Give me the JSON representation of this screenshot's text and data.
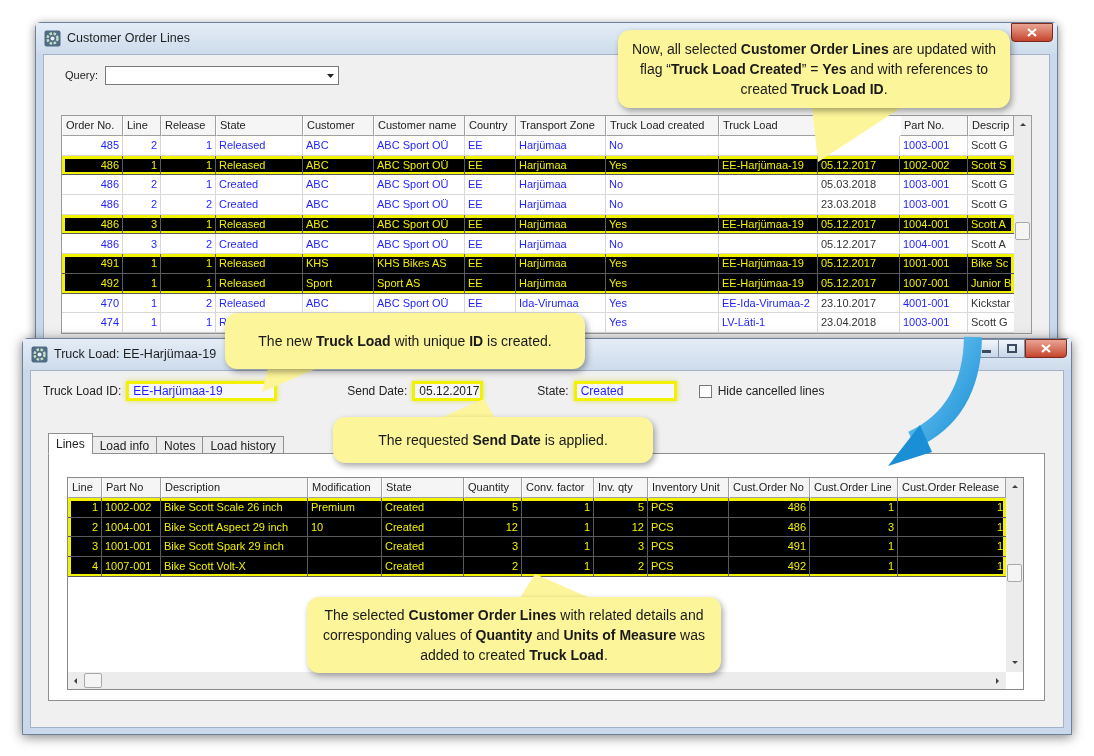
{
  "top_window": {
    "title": "Customer Order Lines",
    "query_label": "Query:",
    "table": {
      "columns": [
        "Order No.",
        "Line",
        "Release",
        "State",
        "Customer",
        "Customer name",
        "Country",
        "Transport Zone",
        "Truck Load created",
        "Truck Load",
        null,
        "Part No.",
        "Descrip"
      ],
      "rows": [
        {
          "selected": false,
          "cells": [
            "485",
            "2",
            "1",
            "Released",
            "ABC",
            "ABC Sport OÜ",
            "EE",
            "Harjümaa",
            "No",
            null,
            null,
            "1003-001",
            "Scott G"
          ]
        },
        {
          "selected": true,
          "cells": [
            "486",
            "1",
            "1",
            "Released",
            "ABC",
            "ABC Sport OÜ",
            "EE",
            "Harjümaa",
            "Yes",
            "EE-Harjümaa-19",
            "05.12.2017",
            "1002-002",
            "Scott S"
          ]
        },
        {
          "selected": false,
          "cells": [
            "486",
            "2",
            "1",
            "Created",
            "ABC",
            "ABC Sport OÜ",
            "EE",
            "Harjümaa",
            "No",
            null,
            "05.03.2018",
            "1003-001",
            "Scott G"
          ]
        },
        {
          "selected": false,
          "cells": [
            "486",
            "2",
            "2",
            "Created",
            "ABC",
            "ABC Sport OÜ",
            "EE",
            "Harjümaa",
            "No",
            null,
            "23.03.2018",
            "1003-001",
            "Scott G"
          ]
        },
        {
          "selected": true,
          "cells": [
            "486",
            "3",
            "1",
            "Released",
            "ABC",
            "ABC Sport OÜ",
            "EE",
            "Harjümaa",
            "Yes",
            "EE-Harjümaa-19",
            "05.12.2017",
            "1004-001",
            "Scott A"
          ]
        },
        {
          "selected": false,
          "cells": [
            "486",
            "3",
            "2",
            "Created",
            "ABC",
            "ABC Sport OÜ",
            "EE",
            "Harjümaa",
            "No",
            null,
            "05.12.2017",
            "1004-001",
            "Scott A"
          ]
        },
        {
          "selected": true,
          "cells": [
            "491",
            "1",
            "1",
            "Released",
            "KHS",
            "KHS Bikes AS",
            "EE",
            "Harjümaa",
            "Yes",
            "EE-Harjümaa-19",
            "05.12.2017",
            "1001-001",
            "Bike Sc"
          ]
        },
        {
          "selected": true,
          "cells": [
            "492",
            "1",
            "1",
            "Released",
            "Sport",
            "Sport AS",
            "EE",
            "Harjümaa",
            "Yes",
            "EE-Harjümaa-19",
            "05.12.2017",
            "1007-001",
            "Junior B"
          ]
        },
        {
          "selected": false,
          "cells": [
            "470",
            "1",
            "2",
            "Released",
            "ABC",
            "ABC Sport OÜ",
            "EE",
            "Ida-Virumaa",
            "Yes",
            "EE-Ida-Virumaa-2",
            "23.10.2017",
            "4001-001",
            "Kickstar"
          ]
        },
        {
          "selected": false,
          "cells": [
            "474",
            "1",
            "1",
            "R",
            null,
            null,
            null,
            null,
            "Yes",
            "LV-Läti-1",
            "23.04.2018",
            "1003-001",
            "Scott G"
          ]
        }
      ]
    }
  },
  "bottom_window": {
    "title": "Truck Load: EE-Harjümaa-19",
    "fields": [
      {
        "label": "Truck Load ID:",
        "value": "EE-Harjümaa-19",
        "highlighted": true
      },
      {
        "label": "Send Date:",
        "value": "05.12.2017",
        "highlighted": true
      },
      {
        "label": "State:",
        "value": "Created",
        "highlighted": true
      }
    ],
    "hide_cancelled": {
      "label": "Hide cancelled lines",
      "checked": false
    },
    "tabs": [
      {
        "label": "Lines",
        "selected": true
      },
      {
        "label": "Load info",
        "selected": false
      },
      {
        "label": "Notes",
        "selected": false
      },
      {
        "label": "Load history",
        "selected": false
      }
    ],
    "table": {
      "columns": [
        "Line",
        "Part No",
        "Description",
        "Modification",
        "State",
        "Quantity",
        "Conv. factor",
        "Inv. qty",
        "Inventory Unit",
        "Cust.Order No",
        "Cust.Order Line",
        "Cust.Order Release"
      ],
      "rows": [
        {
          "selected": true,
          "cells": [
            "1",
            "1002-002",
            "Bike Scott Scale 26 inch",
            "Premium",
            "Created",
            "5",
            "1",
            "5",
            "PCS",
            "486",
            "1",
            "1"
          ]
        },
        {
          "selected": true,
          "cells": [
            "2",
            "1004-001",
            "Bike Scott Aspect 29 inch",
            "10",
            "Created",
            "12",
            "1",
            "12",
            "PCS",
            "486",
            "3",
            "1"
          ]
        },
        {
          "selected": true,
          "cells": [
            "3",
            "1001-001",
            "Bike Scott Spark 29 inch",
            null,
            "Created",
            "3",
            "1",
            "3",
            "PCS",
            "491",
            "1",
            "1"
          ]
        },
        {
          "selected": true,
          "cells": [
            "4",
            "1007-001",
            "Bike Scott Volt-X",
            null,
            "Created",
            "2",
            "1",
            "2",
            "PCS",
            "492",
            "1",
            "1"
          ]
        }
      ]
    }
  },
  "callouts": [
    "Now, all selected **Customer Order Lines** are updated with flag “**Truck Load Created**” = **Yes** and with references to created **Truck Load ID**.",
    "The new **Truck Load** with unique **ID** is created.",
    "The requested **Send Date** is applied.",
    "The selected **Customer Order Lines** with related details and corresponding values of **Quantity** and **Units of Measure** was added to created **Truck Load**."
  ]
}
